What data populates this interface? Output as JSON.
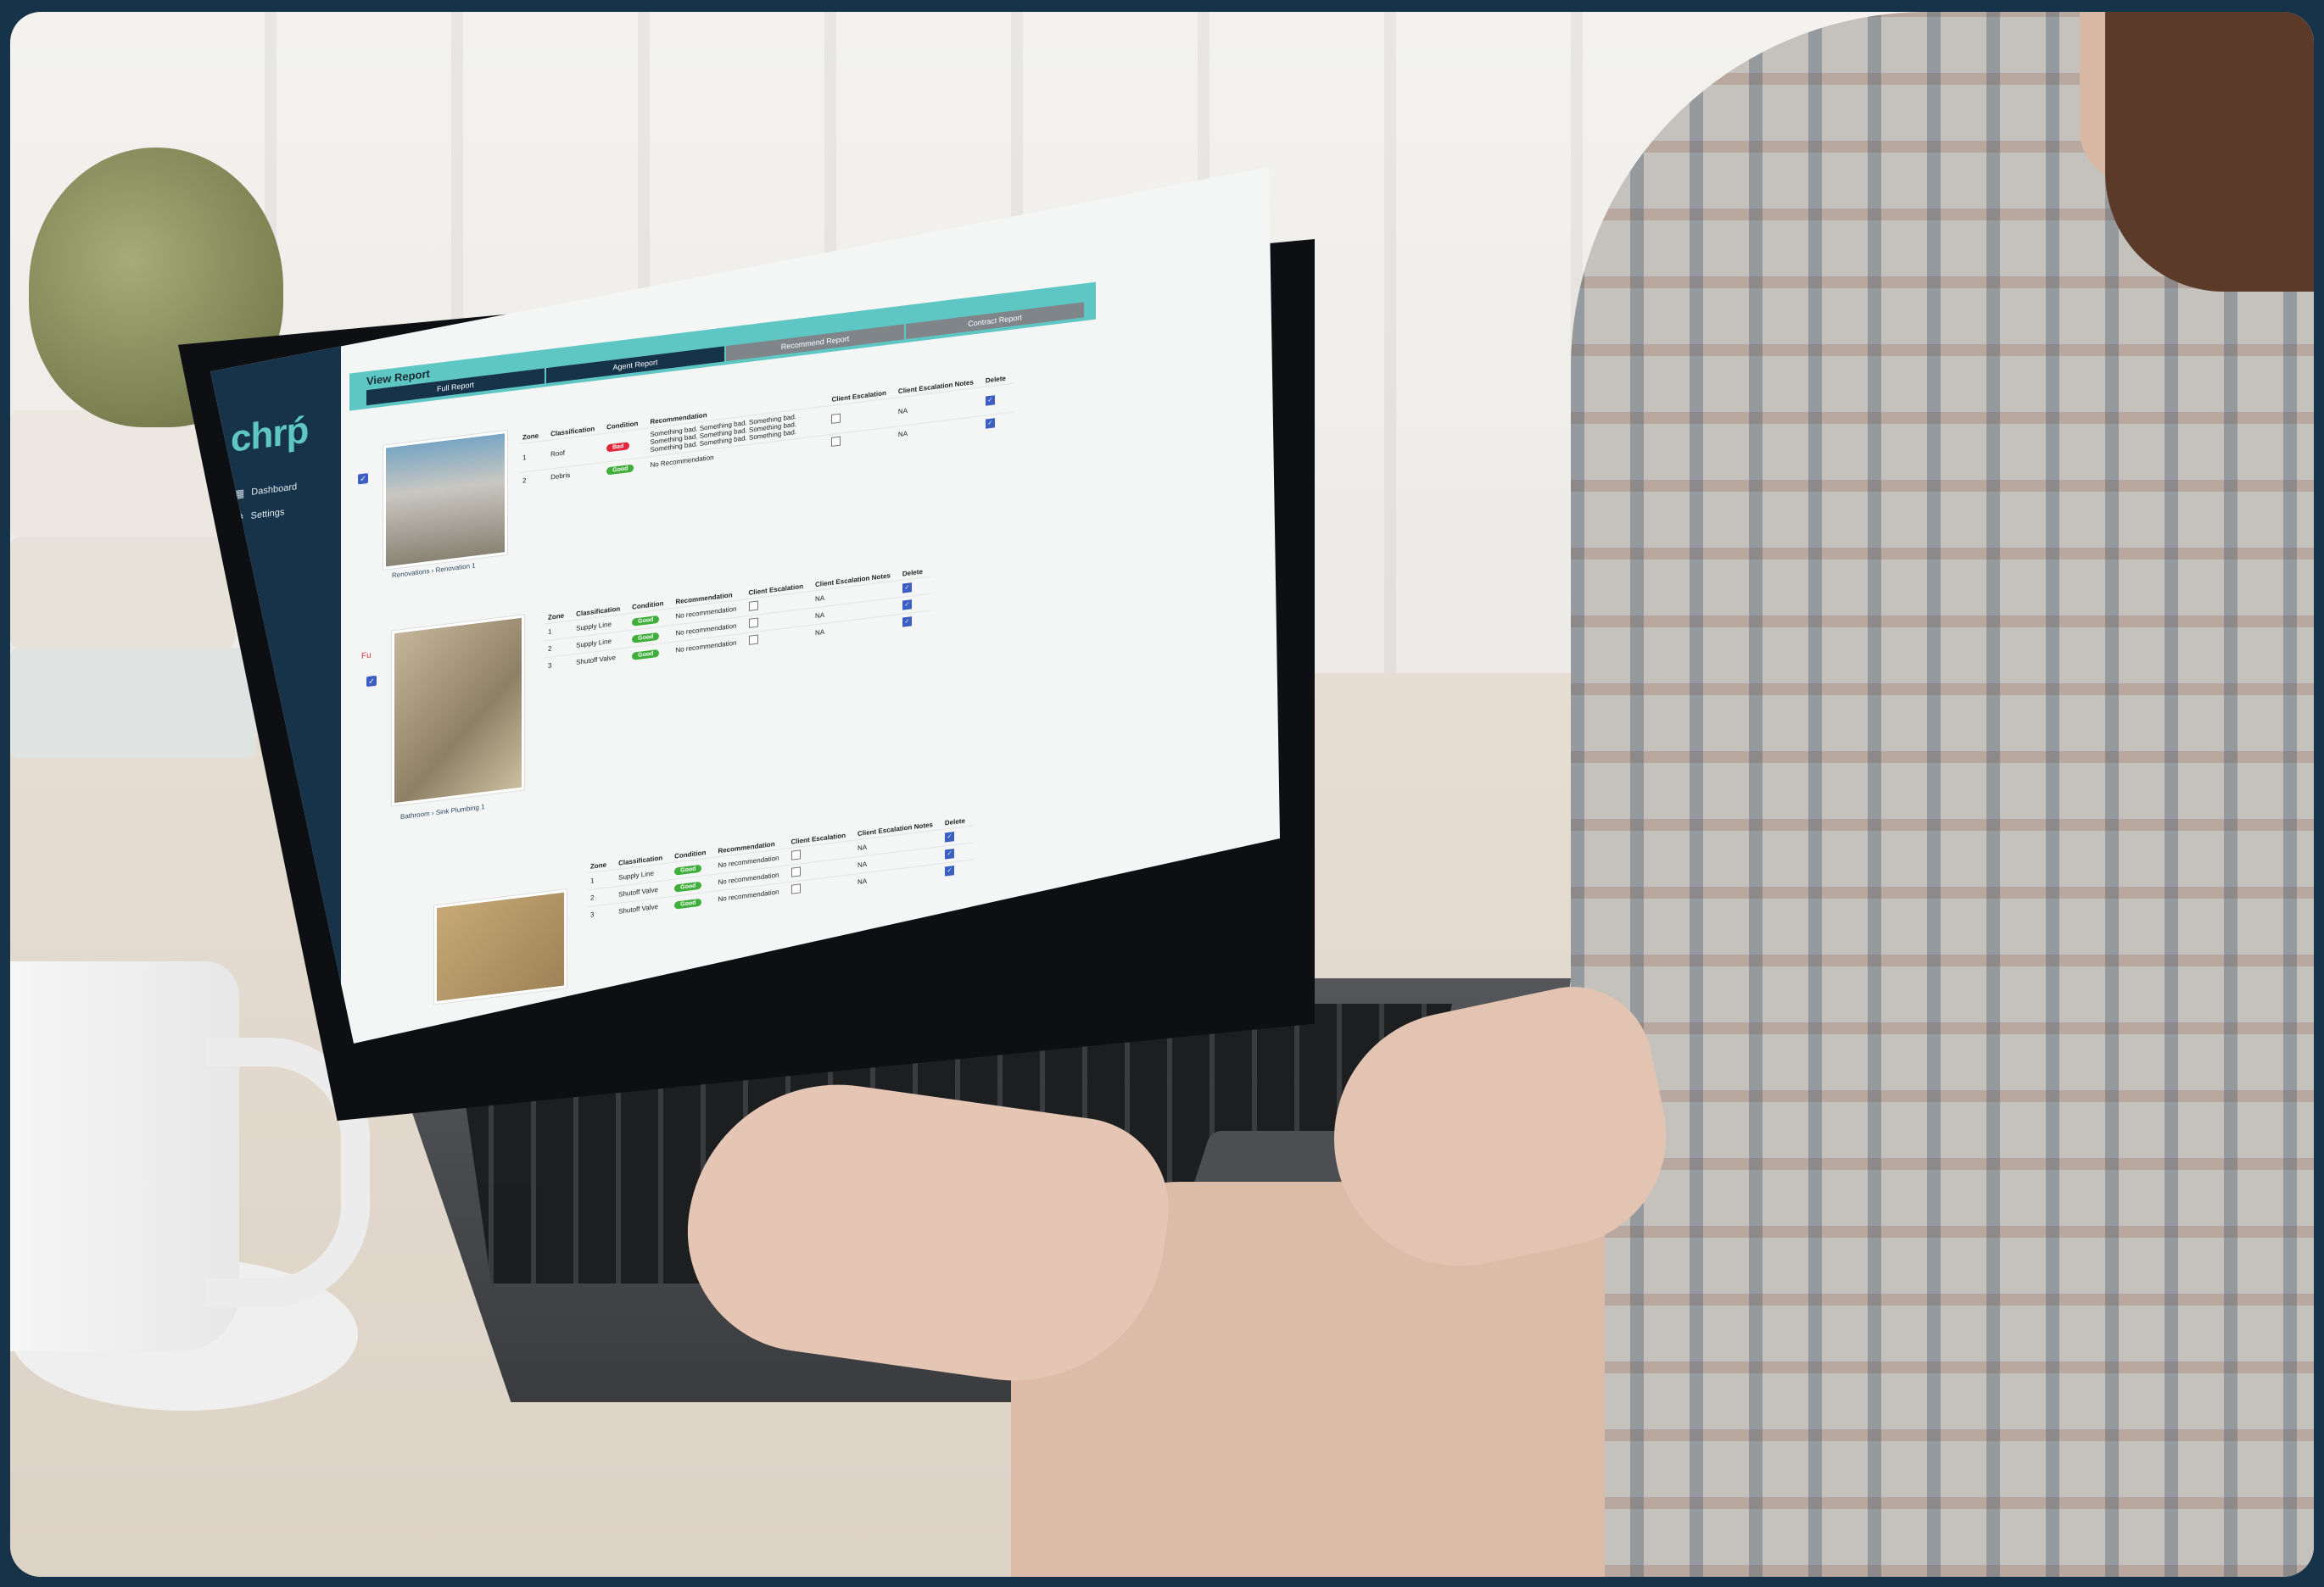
{
  "app": {
    "logo": "chrṕ"
  },
  "sidebar": {
    "items": [
      {
        "label": "Dashboard",
        "icon": "grid-icon"
      },
      {
        "label": "Settings",
        "icon": "gear-icon"
      }
    ]
  },
  "page": {
    "title": "View Report"
  },
  "tabs": [
    {
      "label": "Full Report",
      "active": true
    },
    {
      "label": "Agent Report",
      "active": true
    },
    {
      "label": "Recommend Report",
      "active": false
    },
    {
      "label": "Contract Report",
      "active": false
    }
  ],
  "table_headers": {
    "zone": "Zone",
    "classification": "Classification",
    "condition": "Condition",
    "recommendation": "Recommendation",
    "client_escalation": "Client Escalation",
    "client_escalation_notes": "Client Escalation Notes",
    "delete": "Delete"
  },
  "sections": [
    {
      "breadcrumb": {
        "parent": "Renovations",
        "child": "Renovation 1"
      },
      "rows": [
        {
          "zone": "1",
          "classification": "Roof",
          "condition": "Bad",
          "recommendation": "Something bad. Something bad. Something bad. Something bad. Something bad. Something bad. Something bad. Something bad. Something bad.",
          "notes": "NA"
        },
        {
          "zone": "2",
          "classification": "Debris",
          "condition": "Good",
          "recommendation": "No Recommendation",
          "notes": "NA"
        }
      ]
    },
    {
      "fragment": "Fu",
      "breadcrumb": {
        "parent": "Bathroom",
        "child": "Sink Plumbing 1"
      },
      "rows": [
        {
          "zone": "1",
          "classification": "Supply Line",
          "condition": "Good",
          "recommendation": "No recommendation",
          "notes": "NA"
        },
        {
          "zone": "2",
          "classification": "Supply Line",
          "condition": "Good",
          "recommendation": "No recommendation",
          "notes": "NA"
        },
        {
          "zone": "3",
          "classification": "Shutoff Valve",
          "condition": "Good",
          "recommendation": "No recommendation",
          "notes": "NA"
        }
      ]
    },
    {
      "rows": [
        {
          "zone": "1",
          "classification": "Supply Line",
          "condition": "Good",
          "recommendation": "No recommendation",
          "notes": "NA"
        },
        {
          "zone": "2",
          "classification": "Shutoff Valve",
          "condition": "Good",
          "recommendation": "No recommendation",
          "notes": "NA"
        },
        {
          "zone": "3",
          "classification": "Shutoff Valve",
          "condition": "Good",
          "recommendation": "No recommendation",
          "notes": "NA"
        }
      ]
    }
  ],
  "colors": {
    "sidebar": "#17334a",
    "accent": "#5fc7c3",
    "bad": "#e0283a",
    "good": "#3fae3a",
    "check": "#3d5fc4"
  }
}
